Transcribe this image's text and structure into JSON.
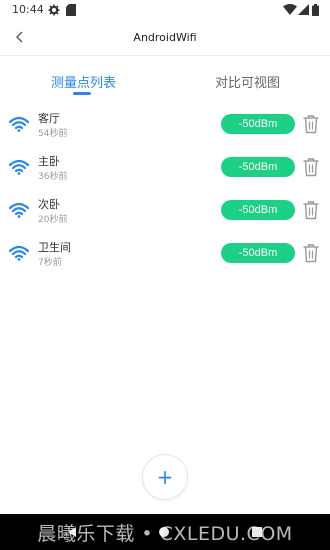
{
  "status_bar": {
    "time": "10:44",
    "icons": [
      "gear-icon",
      "sd-card-icon",
      "wifi-signal-icon",
      "cell-signal-icon",
      "battery-icon"
    ]
  },
  "app_bar": {
    "title": "AndroidWifi"
  },
  "tabs": [
    {
      "label": "测量点列表",
      "active": true
    },
    {
      "label": "对比可视图",
      "active": false
    }
  ],
  "points": [
    {
      "name": "客厅",
      "time": "54秒前",
      "signal": "-50dBm"
    },
    {
      "name": "主卧",
      "time": "36秒前",
      "signal": "-50dBm"
    },
    {
      "name": "次卧",
      "time": "20秒前",
      "signal": "-50dBm"
    },
    {
      "name": "卫生间",
      "time": "7秒前",
      "signal": "-50dBm"
    }
  ],
  "fab": {
    "label": "+"
  },
  "nav_bar": {
    "watermark": "晨曦乐下载 • CXLEDU.COM"
  },
  "colors": {
    "accent": "#2a86e8",
    "signal_badge": "#1ecf86",
    "icon_gray": "#9a9a9a"
  }
}
